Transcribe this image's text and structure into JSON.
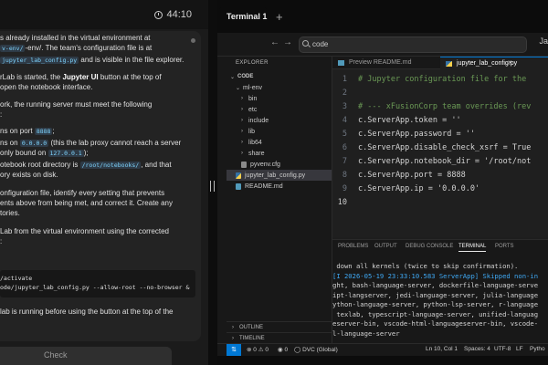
{
  "timer": {
    "value": "44:10"
  },
  "instructions": {
    "lines": [
      "s already installed in the virtual environment at",
      "-env/. The team's configuration file is at",
      "and is visible in the file explorer.",
      "rLab is started, the",
      "button at the top of",
      "open the notebook interface.",
      "ork, the running server must meet the following",
      "ns on port",
      "ns on",
      "(this the lab proxy cannot reach a server",
      "only bound on",
      "otebook root directory is",
      ", and that",
      "ory exists on disk.",
      "onfiguration file, identify every setting that prevents",
      "ents above from being met, and correct it. Create any",
      "tories.",
      "Lab from the virtual environment using the corrected",
      "lab is running before using the button at the top of the"
    ],
    "codes": {
      "venv": "v-env/",
      "config_path": "jupyter_lab_config.py",
      "port": "8888",
      "ip_all": "0.0.0.0",
      "ip_local": "127.0.0.1",
      "root_dir": "/root/notebooks/"
    },
    "bold_jupyter_ui": "Jupyter UI",
    "command": {
      "line1": "/activate",
      "line2": "ode/jupyter_lab_config.py --allow-root --no-browser &"
    },
    "check_label": "Check"
  },
  "window": {
    "tab_label": "Terminal 1",
    "search_text": "code",
    "account": "Ja"
  },
  "explorer": {
    "title": "EXPLORER",
    "root": "CODE",
    "tree": [
      {
        "label": "ml-env",
        "indent": 1,
        "type": "folder",
        "open": true
      },
      {
        "label": "bin",
        "indent": 2,
        "type": "folder"
      },
      {
        "label": "etc",
        "indent": 2,
        "type": "folder"
      },
      {
        "label": "include",
        "indent": 2,
        "type": "folder"
      },
      {
        "label": "lib",
        "indent": 2,
        "type": "folder"
      },
      {
        "label": "lib64",
        "indent": 2,
        "type": "folder"
      },
      {
        "label": "share",
        "indent": 2,
        "type": "folder"
      },
      {
        "label": "pyvenv.cfg",
        "indent": 2,
        "type": "cfg"
      },
      {
        "label": "jupyter_lab_config.py",
        "indent": 1,
        "type": "py",
        "selected": true
      },
      {
        "label": "README.md",
        "indent": 1,
        "type": "md"
      }
    ],
    "outline": "OUTLINE",
    "timeline": "TIMELINE"
  },
  "editor": {
    "tabs": [
      {
        "label": "Preview README.md"
      },
      {
        "label": "jupyter_lab_config.py"
      }
    ],
    "lines": [
      "# Jupyter configuration file for the",
      "",
      "# --- xFusionCorp team overrides (rev",
      "c.ServerApp.token = ''",
      "c.ServerApp.password = ''",
      "c.ServerApp.disable_check_xsrf = True",
      "c.ServerApp.notebook_dir = '/root/not",
      "c.ServerApp.port = 8888",
      "c.ServerApp.ip = '0.0.0.0'",
      ""
    ]
  },
  "panel": {
    "tabs": [
      "PROBLEMS",
      "OUTPUT",
      "DEBUG CONSOLE",
      "TERMINAL",
      "PORTS"
    ],
    "terminal": [
      " down all kernels (twice to skip confirmation).",
      "[I 2026-05-19 23:33:10.583 ServerApp] Skipped non-in",
      "ght, bash-language-server, dockerfile-language-serve",
      "ipt-langserver, jedi-language-server, julia-language",
      "ython-language-server, python-lsp-server, r-language",
      " texlab, typescript-language-server, unified-languag",
      "eserver-bin, vscode-html-languageserver-bin, vscode-",
      "l-language-server"
    ]
  },
  "status": {
    "errors": "0",
    "warnings": "0",
    "info": "0",
    "dvc": "DVC (Global)",
    "position": "Ln 10, Col 1",
    "spaces": "Spaces: 4",
    "encoding": "UTF-8",
    "eol": "LF",
    "language": "Pytho"
  }
}
